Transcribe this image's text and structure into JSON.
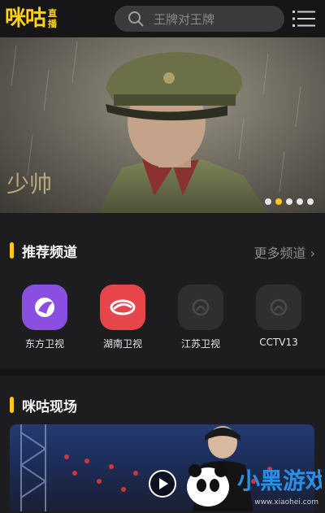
{
  "header": {
    "logo_main": "咪咕",
    "logo_sub_1": "直",
    "logo_sub_2": "播",
    "search_placeholder": "王牌对王牌"
  },
  "banner": {
    "dot_count": 5,
    "active_dot_index": 1
  },
  "recommended": {
    "title": "推荐频道",
    "more_label": "更多频道"
  },
  "channels": [
    {
      "name": "东方卫视",
      "icon": "dongfang-logo-icon",
      "color": "#8a4fe0"
    },
    {
      "name": "湖南卫视",
      "icon": "hunan-logo-icon",
      "color": "#e6454a"
    },
    {
      "name": "江苏卫视",
      "icon": "jiangsu-logo-icon",
      "color": "#2f2f32"
    },
    {
      "name": "CCTV13",
      "icon": "cctv13-logo-icon",
      "color": "#2f2f32"
    }
  ],
  "live": {
    "title": "咪咕现场"
  },
  "watermark": {
    "brand": "小黑游戏",
    "url": "www.xiaohei.com"
  },
  "colors": {
    "accent": "#ffc81e",
    "background": "#1d1d1f"
  }
}
